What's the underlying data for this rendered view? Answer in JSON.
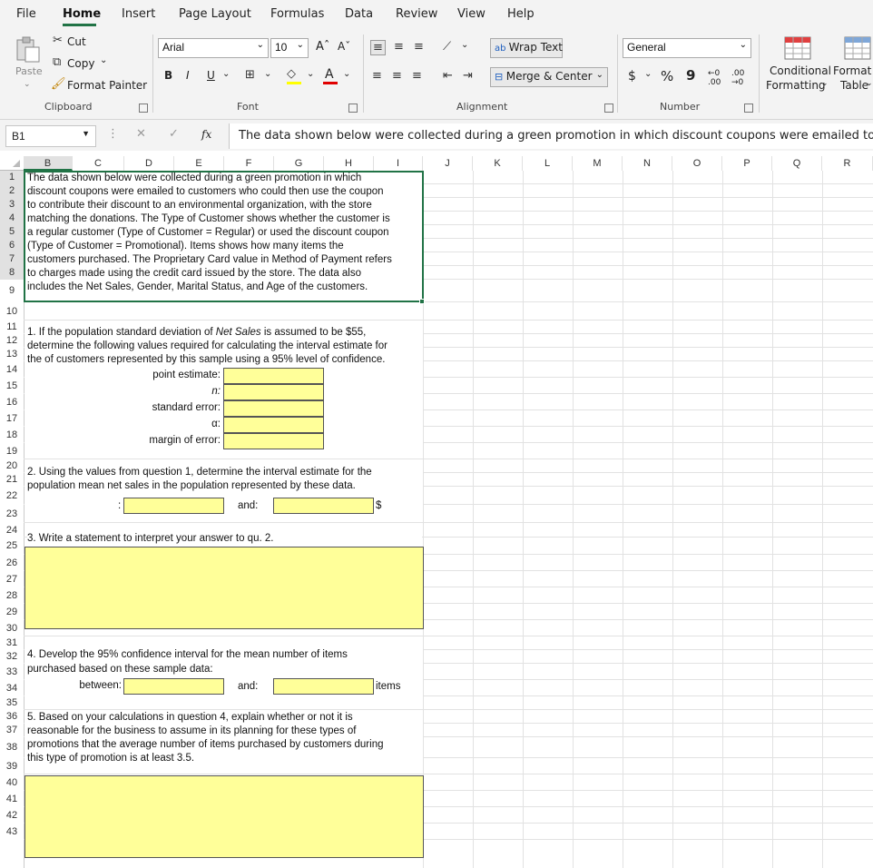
{
  "menu": [
    "File",
    "Home",
    "Insert",
    "Page Layout",
    "Formulas",
    "Data",
    "Review",
    "View",
    "Help"
  ],
  "ribbon": {
    "clipboard": {
      "paste": "Paste",
      "cut": "Cut",
      "copy": "Copy",
      "format_painter": "Format Painter",
      "label": "Clipboard"
    },
    "font": {
      "name": "Arial",
      "size": "10",
      "bold": "B",
      "italic": "I",
      "underline": "U",
      "grow": "Aˆ",
      "shrink": "Aˇ",
      "font_color_letter": "A",
      "label": "Font"
    },
    "alignment": {
      "wrap": "Wrap Text",
      "merge": "Merge & Center",
      "label": "Alignment"
    },
    "number": {
      "format": "General",
      "currency": "$",
      "percent": "%",
      "comma": "9",
      "label": "Number"
    },
    "styles": {
      "conditional_1": "Conditional",
      "conditional_2": "Formatting",
      "format_table_1": "Format a",
      "format_table_2": "Table"
    }
  },
  "formula_bar": {
    "cell_ref": "B1",
    "fx": "fx",
    "content": "The data shown below were collected during a green promotion in which discount coupons were emailed to custo"
  },
  "columns": [
    "B",
    "C",
    "D",
    "E",
    "F",
    "G",
    "H",
    "I",
    "J",
    "K",
    "L",
    "M",
    "N",
    "O",
    "P",
    "Q",
    "R"
  ],
  "rows": [
    "1",
    "2",
    "3",
    "4",
    "5",
    "6",
    "7",
    "8",
    "9",
    "10",
    "11",
    "12",
    "13",
    "14",
    "15",
    "16",
    "17",
    "18",
    "19",
    "20",
    "21",
    "22",
    "23",
    "24",
    "25",
    "26",
    "27",
    "28",
    "29",
    "30",
    "31",
    "32",
    "33",
    "34",
    "35",
    "36",
    "37",
    "38",
    "39",
    "40",
    "41",
    "42",
    "43"
  ],
  "intro_lines": [
    "The data shown below were collected during a green promotion in which",
    "discount coupons were emailed to customers who could then use the coupon",
    "to contribute their discount to an environmental organization, with the store",
    "matching the donations. The Type of Customer shows whether the customer is",
    "a regular customer (Type of Customer = Regular) or used the discount coupon",
    "(Type of Customer = Promotional). Items shows how many items the",
    "customers purchased. The Proprietary Card value in Method of Payment refers",
    "to charges made using the credit card issued by the store. The data also",
    "includes the Net Sales, Gender, Marital Status, and Age of the customers."
  ],
  "q1": {
    "line1_a": "1. If the population standard deviation of ",
    "line1_b": "Net Sales",
    "line1_c": " is assumed to be $55,",
    "line2": "determine the following values required for calculating the interval estimate for",
    "line3": "the  of customers represented by this sample using a  95% level of confidence.",
    "labels": [
      "point estimate:",
      "n:",
      "standard error:",
      "α:",
      "margin of error:"
    ]
  },
  "q2": {
    "line1": "2. Using the values from question 1, determine the interval estimate for the",
    "line2": "population mean net sales in the population represented by these data.",
    "colon": ":",
    "and": "and:",
    "dollar": "$"
  },
  "q3": {
    "line1": "3. Write a statement to interpret your answer to qu. 2."
  },
  "q4": {
    "line1": "4. Develop the 95% confidence interval for the mean number of items",
    "line2": "purchased based on these sample data:",
    "between": "between:",
    "and": "and:",
    "items": "items"
  },
  "q5": {
    "lines": [
      "5. Based on your calculations in question 4, explain whether or not it is",
      "reasonable for the business to assume in its planning for these types of",
      "promotions that the average number of items purchased by customers during",
      "this type of promotion is at least 3.5."
    ]
  },
  "colors": {
    "accent": "#217346",
    "input_fill": "#ffff99",
    "selection": "#217346"
  }
}
